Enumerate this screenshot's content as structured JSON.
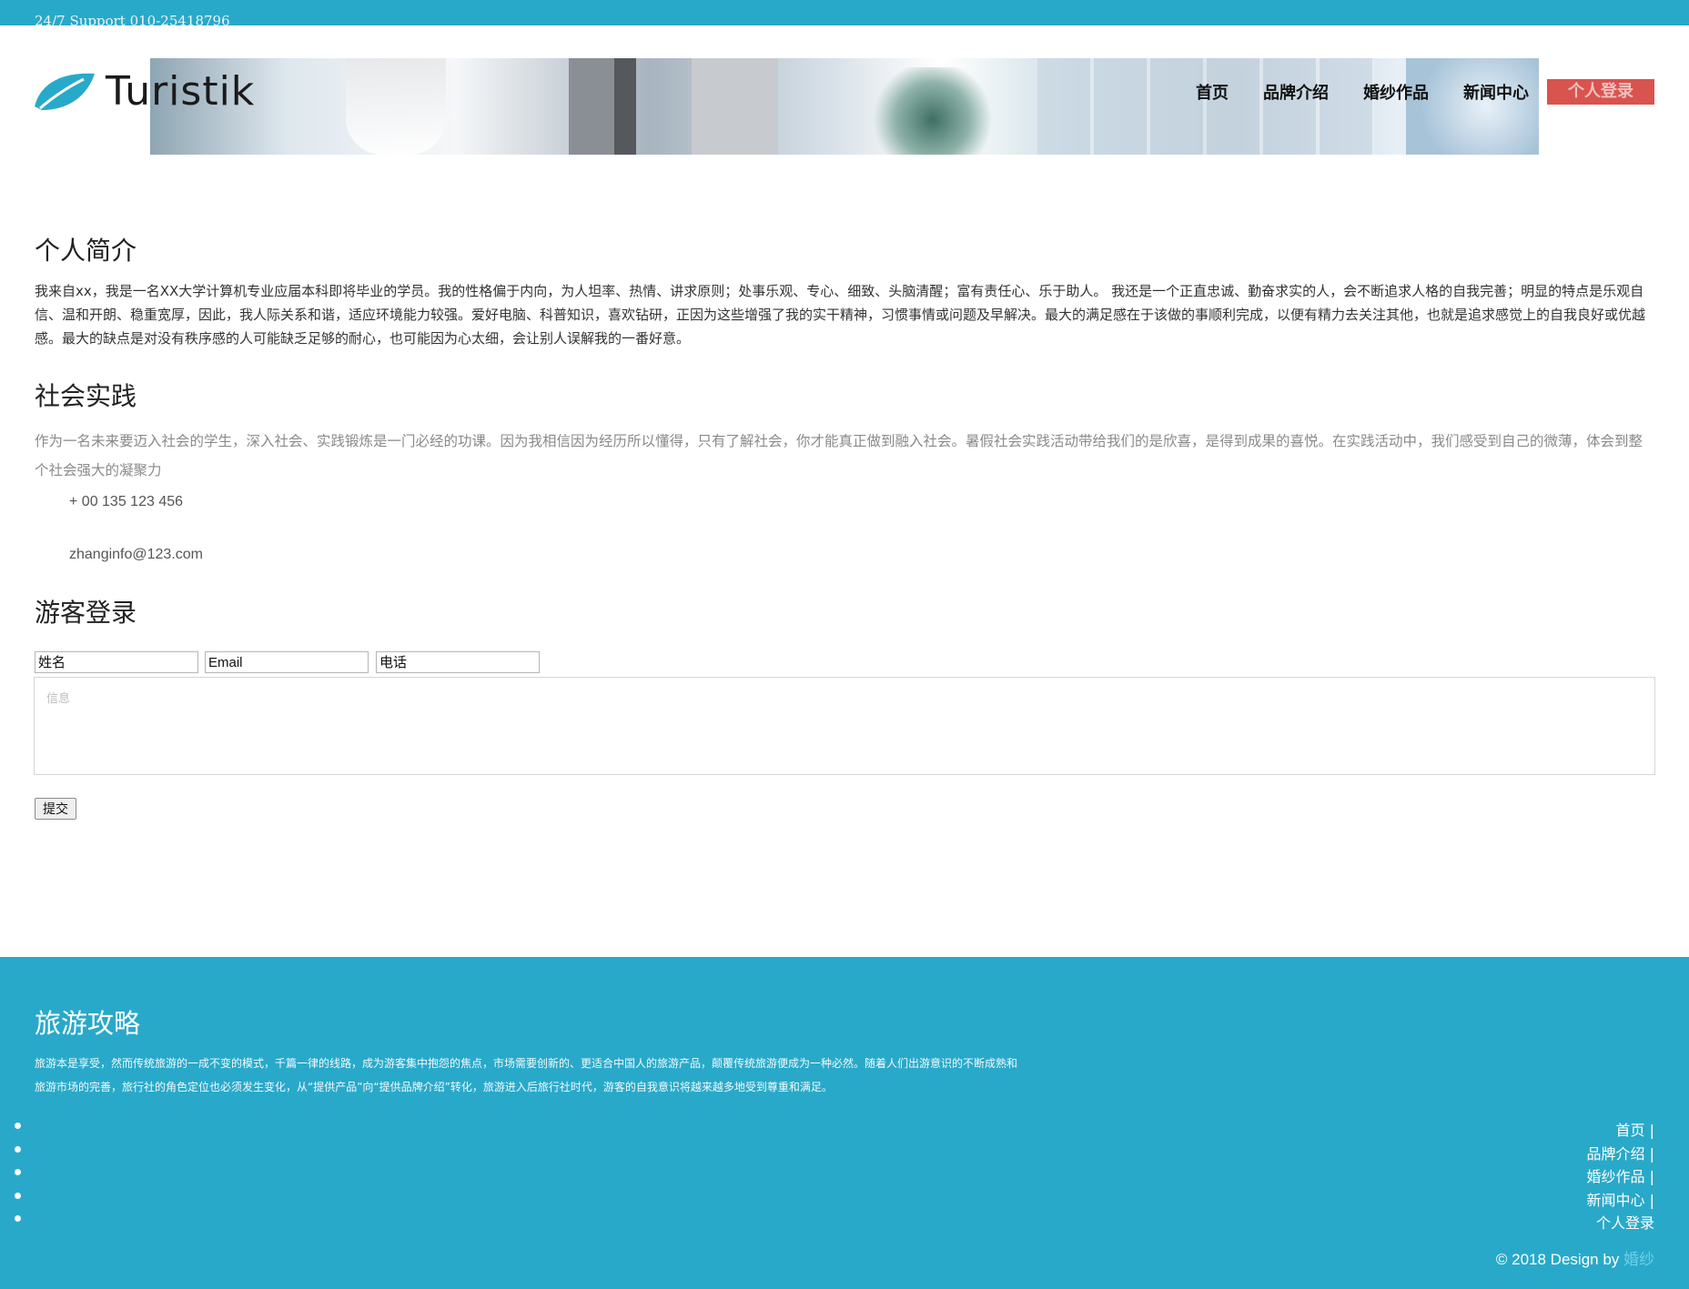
{
  "topbar": {
    "support": "24/7 Support 010-25418796"
  },
  "header": {
    "logo_text": "Turistik",
    "nav": [
      {
        "label": "首页"
      },
      {
        "label": "品牌介绍"
      },
      {
        "label": "婚纱作品"
      },
      {
        "label": "新闻中心"
      },
      {
        "label": "个人登录"
      }
    ],
    "colors": {
      "topbar": "#29a9c9",
      "login_button": "#d9534f"
    }
  },
  "about": {
    "title": "个人简介",
    "text": "我来自xx，我是一名XX大学计算机专业应届本科即将毕业的学员。我的性格偏于内向，为人坦率、热情、讲求原则；处事乐观、专心、细致、头脑清醒；富有责任心、乐于助人。 我还是一个正直忠诚、勤奋求实的人，会不断追求人格的自我完善；明显的特点是乐观自信、温和开朗、稳重宽厚，因此，我人际关系和谐，适应环境能力较强。爱好电脑、科普知识，喜欢钻研，正因为这些增强了我的实干精神，习惯事情或问题及早解决。最大的满足感在于该做的事顺利完成，以便有精力去关注其他，也就是追求感觉上的自我良好或优越感。最大的缺点是对没有秩序感的人可能缺乏足够的耐心，也可能因为心太细，会让别人误解我的一番好意。"
  },
  "practice": {
    "title": "社会实践",
    "text": "作为一名未来要迈入社会的学生，深入社会、实践锻炼是一门必经的功课。因为我相信因为经历所以懂得，只有了解社会，你才能真正做到融入社会。暑假社会实践活动带给我们的是欣喜，是得到成果的喜悦。在实践活动中，我们感受到自己的微薄，体会到整个社会强大的凝聚力",
    "phone": "+ 00 135 123 456",
    "email": "zhanginfo@123.com"
  },
  "guest_login": {
    "title": "游客登录",
    "name_placeholder": "姓名",
    "email_placeholder": "Email",
    "phone_placeholder": "电话",
    "message_placeholder": "信息",
    "submit_label": "提交"
  },
  "footer": {
    "title": "旅游攻略",
    "text": "旅游本是享受，然而传统旅游的一成不变的模式，千篇一律的线路，成为游客集中抱怨的焦点，市场需要创新的、更适合中国人的旅游产品，颠覆传统旅游便成为一种必然。随着人们出游意识的不断成熟和旅游市场的完善，旅行社的角色定位也必须发生变化，从“提供产品”向“提供品牌介绍”转化，旅游进入后旅行社时代，游客的自我意识将越来越多地受到尊重和满足。",
    "links": [
      {
        "label": "首页 |"
      },
      {
        "label": "品牌介绍 |"
      },
      {
        "label": "婚纱作品 |"
      },
      {
        "label": "新闻中心 |"
      },
      {
        "label": "个人登录"
      }
    ],
    "copyright_prefix": "© 2018 Design by ",
    "copyright_link": "婚纱"
  }
}
